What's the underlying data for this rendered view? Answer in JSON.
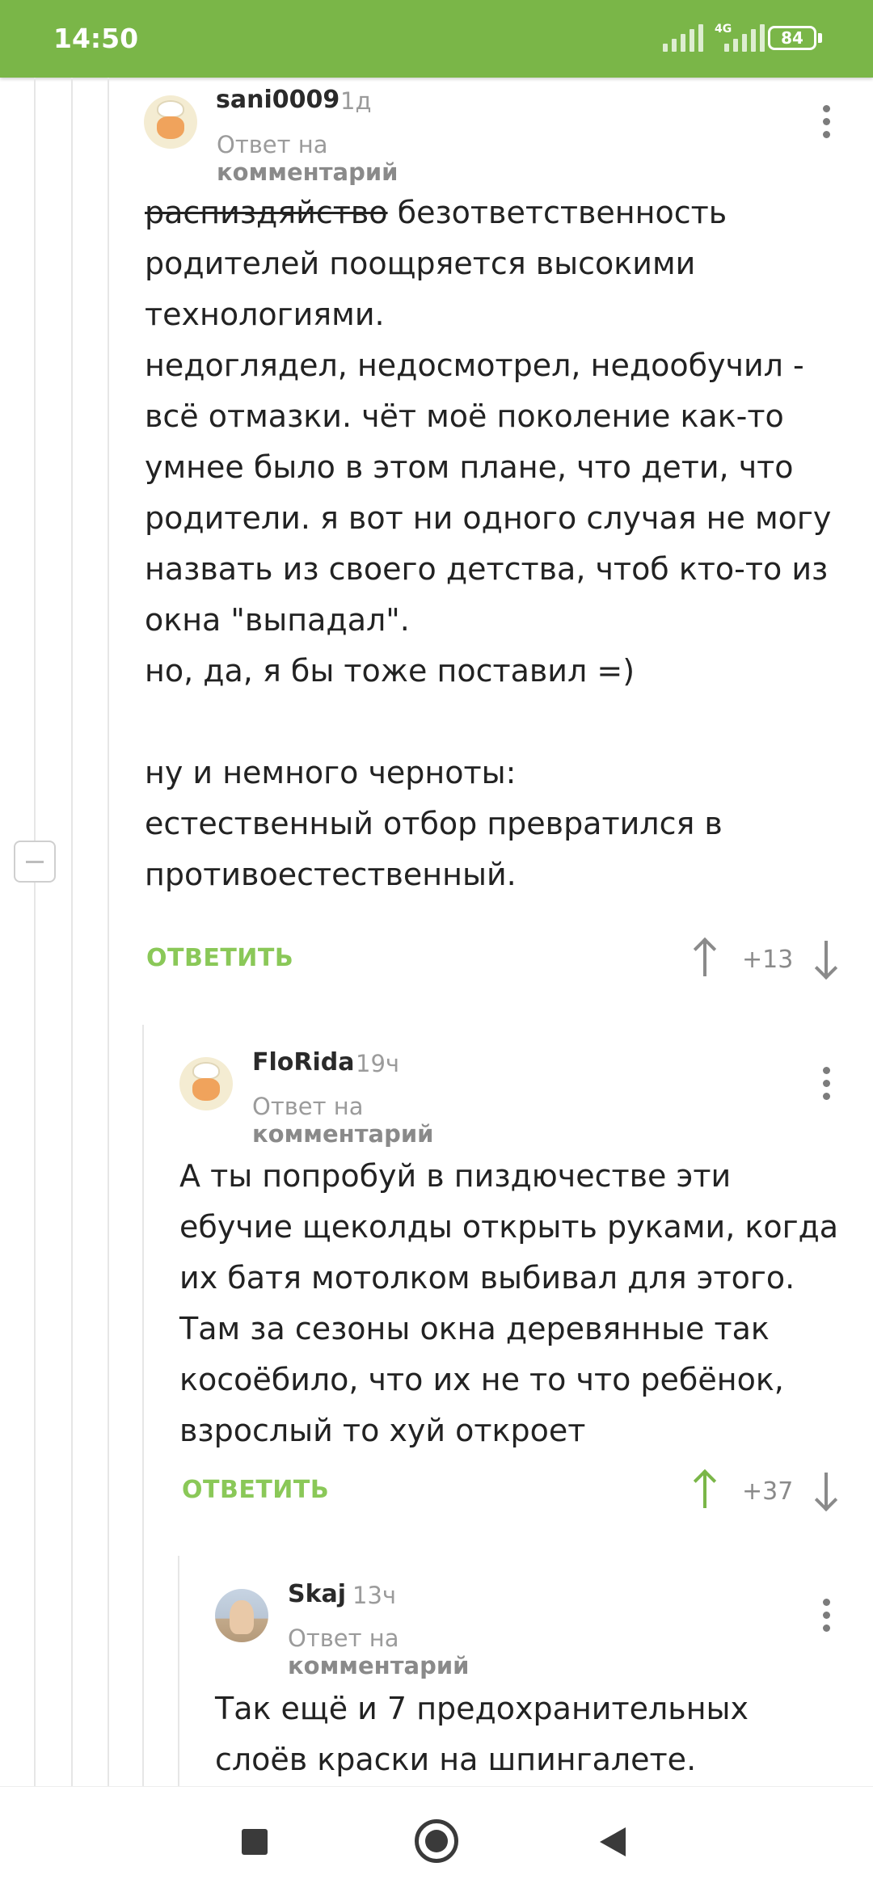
{
  "status_bar": {
    "time": "14:50",
    "network": "4G",
    "battery": "84"
  },
  "comments": [
    {
      "author": "sani0009",
      "time": "1д",
      "reply_prefix": "Ответ на",
      "reply_target": "комментарий",
      "text_strike": "распиздяйство",
      "text": " безответственность родителей поощряется высокими технологиями.\nнедоглядел, недосмотрел, недообучил - всё отмазки. чёт моё поколение как-то умнее было в этом плане, что дети, что родители. я вот ни одного случая не могу назвать из своего детства, чтоб кто-то из окна \"выпадал\".\nно, да, я бы тоже поставил =)\n\nну и немного черноты:\nестественный отбор превратился в противоестественный.",
      "reply_label": "ОТВЕТИТЬ",
      "score": "+13"
    },
    {
      "author": "FloRida",
      "time": "19ч",
      "reply_prefix": "Ответ на",
      "reply_target": "комментарий",
      "text": "А ты попробуй в пиздючестве эти ебучие щеколды открыть руками, когда их батя мотолком выбивал для этого. Там за сезоны окна деревянные так косоёбило, что их не то что ребёнок, взрослый то хуй откроет",
      "reply_label": "ОТВЕТИТЬ",
      "score": "+37"
    },
    {
      "author": "Skaj",
      "time": "13ч",
      "reply_prefix": "Ответ на",
      "reply_target": "комментарий",
      "text": "Так ещё и 7 предохранительных слоёв краски на шпингалете."
    }
  ],
  "icons": {
    "kebab": "more-vert-icon",
    "upvote": "arrow-up-icon",
    "downvote": "arrow-down-icon",
    "collapse": "minus-icon"
  },
  "colors": {
    "brand_green": "#7ab648",
    "reply_green": "#8ac858",
    "muted": "#9b9b9b"
  }
}
